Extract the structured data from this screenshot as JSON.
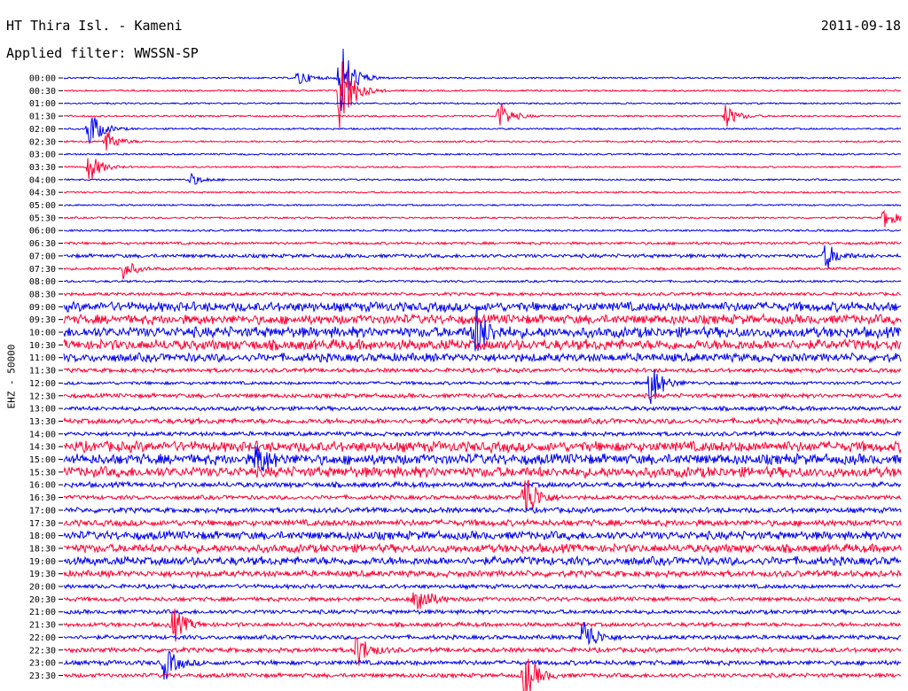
{
  "header": {
    "station": "HT Thira Isl. - Kameni",
    "date": "2011-09-18",
    "filter": "Applied filter: WWSSN-SP"
  },
  "y_axis_label": "EHZ - 50000",
  "colors": {
    "odd_trace": "#0000ee",
    "even_trace": "#ff0033",
    "background": "#ffffff"
  },
  "chart_data": {
    "type": "line",
    "title": "HT Thira Isl. - Kameni",
    "subtitle": "Applied filter: WWSSN-SP",
    "ylabel": "EHZ - 50000",
    "xlabel": "",
    "grid": false,
    "row_labels": [
      "00:00",
      "00:30",
      "01:00",
      "01:30",
      "02:00",
      "02:30",
      "03:00",
      "03:30",
      "04:00",
      "04:30",
      "05:00",
      "05:30",
      "06:00",
      "06:30",
      "07:00",
      "07:30",
      "08:00",
      "08:30",
      "09:00",
      "09:30",
      "10:00",
      "10:30",
      "11:00",
      "11:30",
      "12:00",
      "12:30",
      "13:00",
      "13:30",
      "14:00",
      "14:30",
      "15:00",
      "15:30",
      "16:00",
      "16:30",
      "17:00",
      "17:30",
      "18:00",
      "18:30",
      "19:00",
      "19:30",
      "20:00",
      "20:30",
      "21:00",
      "21:30",
      "22:00",
      "22:30",
      "23:00",
      "23:30"
    ],
    "row_noise_level": [
      0.05,
      0.06,
      0.05,
      0.06,
      0.06,
      0.06,
      0.06,
      0.05,
      0.06,
      0.06,
      0.05,
      0.06,
      0.08,
      0.15,
      0.25,
      0.15,
      0.1,
      0.2,
      0.8,
      0.8,
      0.9,
      0.9,
      0.7,
      0.3,
      0.2,
      0.3,
      0.3,
      0.4,
      0.3,
      0.9,
      0.9,
      0.9,
      0.4,
      0.3,
      0.4,
      0.5,
      0.7,
      0.7,
      0.7,
      0.5,
      0.3,
      0.3,
      0.3,
      0.3,
      0.3,
      0.35,
      0.35,
      0.3
    ],
    "events": [
      {
        "row": 0,
        "t": 0.28,
        "amp": 10
      },
      {
        "row": 0,
        "t": 0.33,
        "amp": 50
      },
      {
        "row": 1,
        "t": 0.33,
        "amp": 60
      },
      {
        "row": 3,
        "t": 0.52,
        "amp": 18
      },
      {
        "row": 3,
        "t": 0.79,
        "amp": 14
      },
      {
        "row": 4,
        "t": 0.03,
        "amp": 25
      },
      {
        "row": 5,
        "t": 0.05,
        "amp": 14
      },
      {
        "row": 7,
        "t": 0.03,
        "amp": 18
      },
      {
        "row": 8,
        "t": 0.15,
        "amp": 8
      },
      {
        "row": 11,
        "t": 0.98,
        "amp": 12
      },
      {
        "row": 14,
        "t": 0.91,
        "amp": 16
      },
      {
        "row": 15,
        "t": 0.07,
        "amp": 12
      },
      {
        "row": 20,
        "t": 0.49,
        "amp": 35
      },
      {
        "row": 24,
        "t": 0.7,
        "amp": 30
      },
      {
        "row": 30,
        "t": 0.23,
        "amp": 20
      },
      {
        "row": 33,
        "t": 0.55,
        "amp": 35
      },
      {
        "row": 41,
        "t": 0.42,
        "amp": 25
      },
      {
        "row": 43,
        "t": 0.13,
        "amp": 22
      },
      {
        "row": 44,
        "t": 0.62,
        "amp": 25
      },
      {
        "row": 45,
        "t": 0.35,
        "amp": 20
      },
      {
        "row": 46,
        "t": 0.12,
        "amp": 20
      },
      {
        "row": 47,
        "t": 0.55,
        "amp": 30
      }
    ]
  }
}
